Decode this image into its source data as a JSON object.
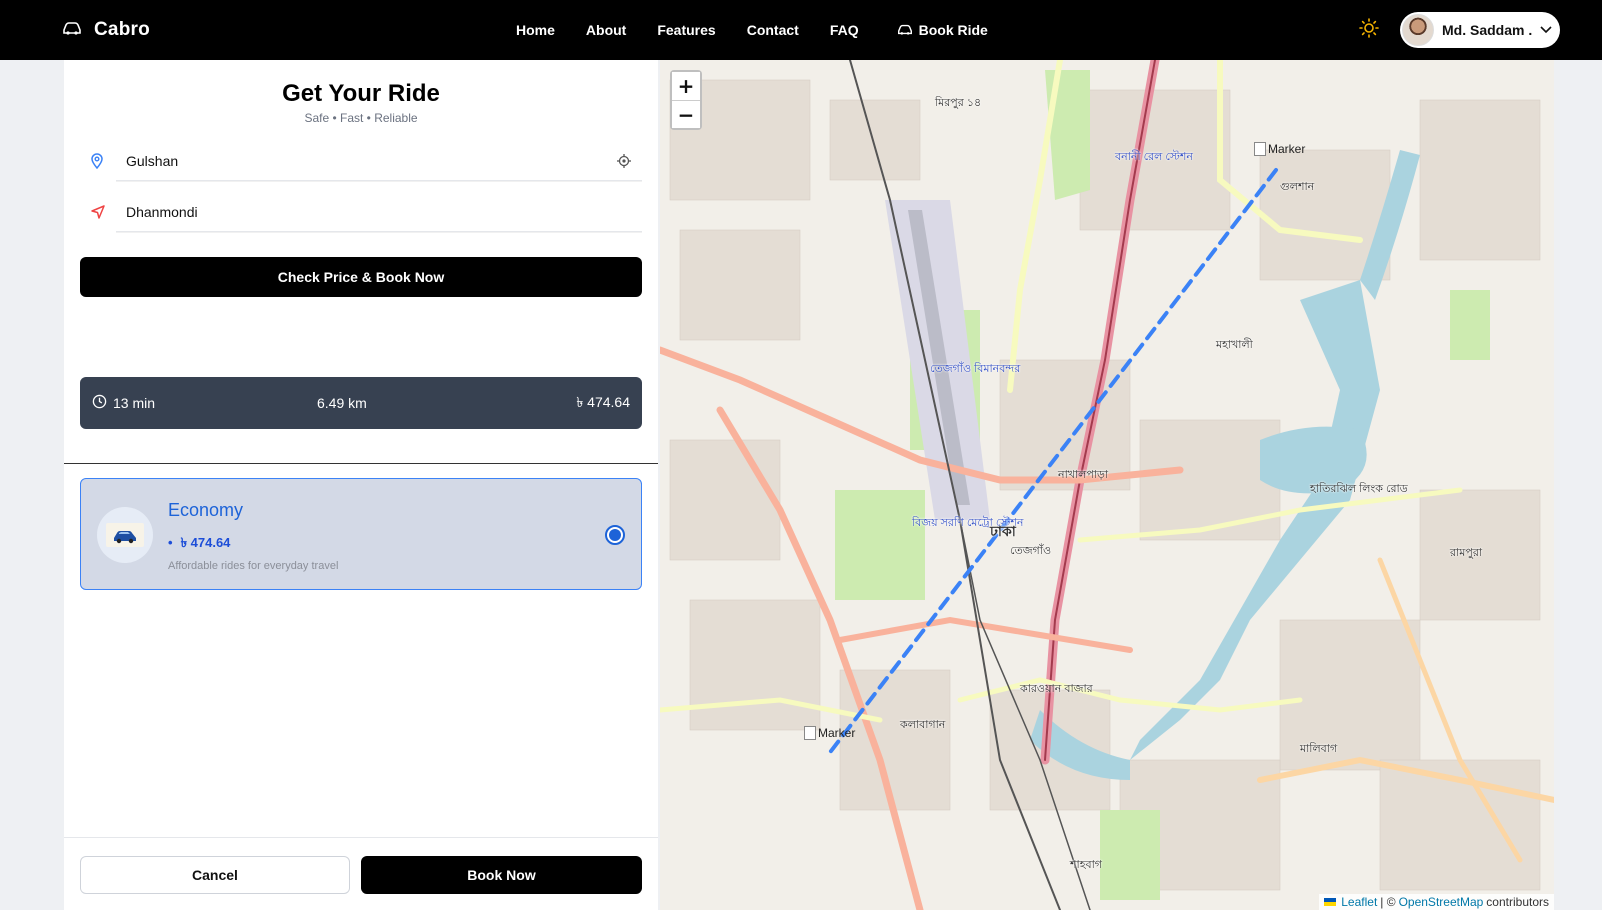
{
  "navbar": {
    "brand": "Cabro",
    "links": [
      "Home",
      "About",
      "Features",
      "Contact",
      "FAQ"
    ],
    "book_ride": "Book Ride",
    "user_name": "Md. Saddam ..."
  },
  "ride_form": {
    "title": "Get Your Ride",
    "subtitle": "Safe • Fast • Reliable",
    "pickup_value": "Gulshan",
    "dropoff_value": "Dhanmondi",
    "check_button": "Check Price & Book Now"
  },
  "trip_summary": {
    "duration": "13 min",
    "distance": "6.49 km",
    "price": "৳ 474.64"
  },
  "ride_option": {
    "name": "Economy",
    "bullet": "•",
    "price": "৳ 474.64",
    "description": "Affordable rides for everyday travel",
    "selected": true
  },
  "actions": {
    "cancel": "Cancel",
    "book": "Book Now"
  },
  "map": {
    "zoom_in": "+",
    "zoom_out": "−",
    "start_marker": "Marker",
    "end_marker": "Marker",
    "labels": [
      "মিরপুর ১৪",
      "বনানী রেল স্টেশন",
      "গুলশান",
      "মহাখালী",
      "তেজগাঁও বিমানবন্দর",
      "বিজয় সরণি মেট্রো স্টেশন",
      "ঢাকা",
      "তেজগাঁও",
      "নাখালপাড়া",
      "কারওয়ান বাজার",
      "কলাবাগান",
      "হাতিরঝিল লিংক রোড",
      "রামপুরা",
      "মালিবাগ",
      "শাহবাগ"
    ],
    "route_color": "#3b82f6",
    "attribution_leaflet": "Leaflet",
    "attribution_sep": "| ©",
    "attribution_osm": "OpenStreetMap",
    "attribution_tail": "contributors"
  }
}
